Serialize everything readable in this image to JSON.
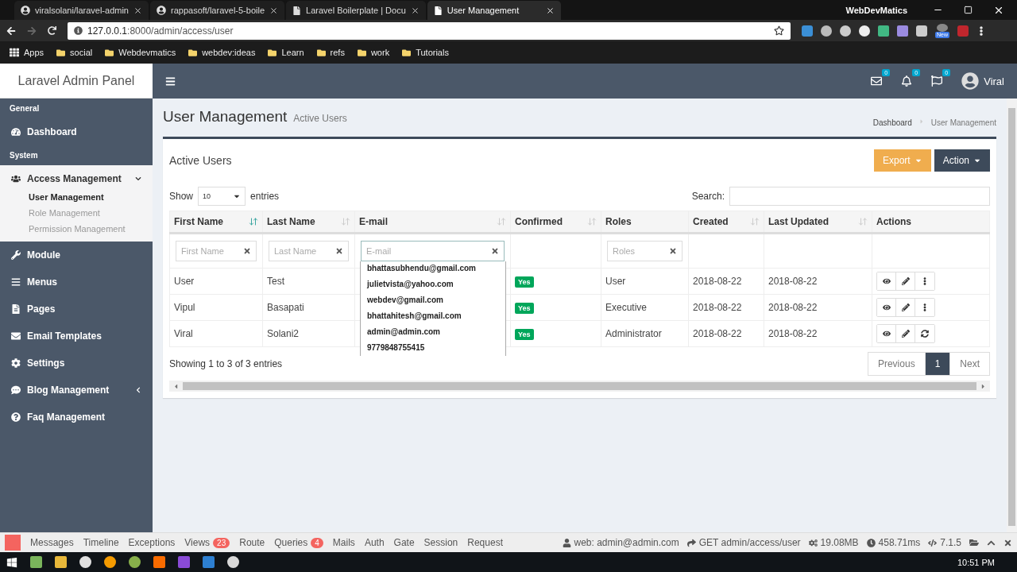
{
  "browser": {
    "tabs": [
      {
        "title": "viralsolani/laravel-admin",
        "selected": false
      },
      {
        "title": "rappasoft/laravel-5-boile",
        "selected": false
      },
      {
        "title": "Laravel Boilerplate | Docu",
        "selected": false
      },
      {
        "title": "User Management",
        "selected": true
      }
    ],
    "window_title": "WebDevMatics",
    "url_host": "127.0.0.1",
    "url_rest": ":8000/admin/access/user",
    "extension_badge": "New",
    "bookmarks": [
      "Apps",
      "social",
      "Webdevmatics",
      "webdev:ideas",
      "Learn",
      "refs",
      "work",
      "Tutorials"
    ]
  },
  "header": {
    "brand": "Laravel Admin Panel",
    "notifications": [
      {
        "kind": "mail",
        "count": "0"
      },
      {
        "kind": "bell",
        "count": "0"
      },
      {
        "kind": "flag",
        "count": "0"
      }
    ],
    "user": "Viral"
  },
  "sidebar": {
    "sections": [
      {
        "heading": "General",
        "items": [
          {
            "label": "Dashboard"
          }
        ]
      },
      {
        "heading": "System",
        "items": [
          {
            "label": "Access Management",
            "expanded": true,
            "children": [
              {
                "label": "User Management",
                "selected": true
              },
              {
                "label": "Role Management",
                "selected": false
              },
              {
                "label": "Permission Management",
                "selected": false
              }
            ]
          },
          {
            "label": "Module"
          },
          {
            "label": "Menus"
          },
          {
            "label": "Pages"
          },
          {
            "label": "Email Templates"
          },
          {
            "label": "Settings"
          },
          {
            "label": "Blog Management",
            "expanded": false
          },
          {
            "label": "Faq Management"
          }
        ]
      }
    ]
  },
  "content": {
    "title": "User Management",
    "subtitle": "Active Users",
    "breadcrumb": [
      "Dashboard",
      "User Management"
    ],
    "card": {
      "title": "Active Users",
      "buttons": [
        {
          "label": "Export",
          "kind": "warning"
        },
        {
          "label": "Action",
          "kind": "dark"
        }
      ],
      "length": {
        "before": "Show",
        "value": "10",
        "after": "entries"
      },
      "search_label": "Search:",
      "columns": [
        {
          "label": "First Name",
          "sorted": true,
          "filter": {
            "placeholder": "First Name",
            "focused": false
          }
        },
        {
          "label": "Last Name",
          "sorted": false,
          "filter": {
            "placeholder": "Last Name",
            "focused": false
          }
        },
        {
          "label": "E-mail",
          "sorted": false,
          "filter": {
            "placeholder": "E-mail",
            "focused": true
          }
        },
        {
          "label": "Confirmed",
          "sorted": false
        },
        {
          "label": "Roles",
          "filter": {
            "placeholder": "Roles",
            "focused": false
          }
        },
        {
          "label": "Created",
          "sorted": false
        },
        {
          "label": "Last Updated",
          "sorted": false
        },
        {
          "label": "Actions"
        }
      ],
      "suggestions": [
        "bhattasubhendu@gmail.com",
        "julietvista@yahoo.com",
        "webdev@gmail.com",
        "bhattahitesh@gmail.com",
        "admin@admin.com",
        "9779848755415"
      ],
      "rows": [
        {
          "first_name": "User",
          "last_name": "Test",
          "confirmed": "Yes",
          "role": "User",
          "created": "2018-08-22",
          "updated": "2018-08-22",
          "actions": [
            {
              "kind": "view"
            },
            {
              "kind": "edit"
            },
            {
              "kind": "more"
            }
          ]
        },
        {
          "first_name": "Vipul",
          "last_name": "Basapati",
          "confirmed": "Yes",
          "role": "Executive",
          "created": "2018-08-22",
          "updated": "2018-08-22",
          "actions": [
            {
              "kind": "view"
            },
            {
              "kind": "edit"
            },
            {
              "kind": "more"
            }
          ]
        },
        {
          "first_name": "Viral",
          "last_name": "Solani2",
          "confirmed": "Yes",
          "role": "Administrator",
          "created": "2018-08-22",
          "updated": "2018-08-22",
          "actions": [
            {
              "kind": "view"
            },
            {
              "kind": "edit"
            },
            {
              "kind": "refresh"
            }
          ]
        }
      ],
      "info": "Showing 1 to 3 of 3 entries",
      "pagination": [
        {
          "label": "Previous",
          "selected": false
        },
        {
          "label": "1",
          "selected": true
        },
        {
          "label": "Next",
          "selected": false
        }
      ]
    }
  },
  "debugbar": {
    "tabs": [
      {
        "label": "Messages"
      },
      {
        "label": "Timeline"
      },
      {
        "label": "Exceptions"
      },
      {
        "label": "Views",
        "badge": "23"
      },
      {
        "label": "Route"
      },
      {
        "label": "Queries",
        "badge": "4"
      },
      {
        "label": "Mails"
      },
      {
        "label": "Auth"
      },
      {
        "label": "Gate"
      },
      {
        "label": "Session"
      },
      {
        "label": "Request"
      }
    ],
    "status": [
      {
        "kind": "user",
        "text": "web: admin@admin.com"
      },
      {
        "kind": "route",
        "text": "GET admin/access/user"
      },
      {
        "kind": "memory",
        "text": "19.08MB"
      },
      {
        "kind": "time",
        "text": "458.71ms"
      },
      {
        "kind": "php",
        "text": "7.1.5"
      }
    ]
  },
  "taskbar": {
    "time": "10:51 PM"
  }
}
